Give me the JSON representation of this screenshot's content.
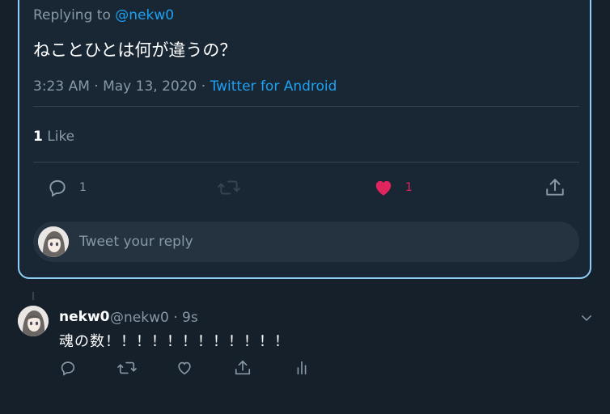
{
  "focused_tweet": {
    "replying_prefix": "Replying to",
    "replying_handle": "@nekw0",
    "text": "ねことひとは何が違うの？",
    "time": "3:23 AM · May 13, 2020 · ",
    "client": "Twitter for Android",
    "like_count": "1",
    "like_label": " Like",
    "actions": {
      "reply_count": "1",
      "retweet_count": "",
      "like_count": "1"
    },
    "reply_placeholder": "Tweet your reply"
  },
  "reply_tweet": {
    "name": "nekw0",
    "handle_time": "@nekw0 · 9s",
    "text": "魂の数！！！！！！！！！！！！"
  },
  "colors": {
    "background": "#15202b",
    "card": "#192734",
    "accent": "#1da1f2",
    "like": "#e0245e",
    "muted": "#8899a6",
    "focus_border": "#8ecdf8"
  },
  "icons": [
    "reply-icon",
    "retweet-icon",
    "heart-icon",
    "share-icon",
    "chevron-down-icon",
    "analytics-icon"
  ]
}
